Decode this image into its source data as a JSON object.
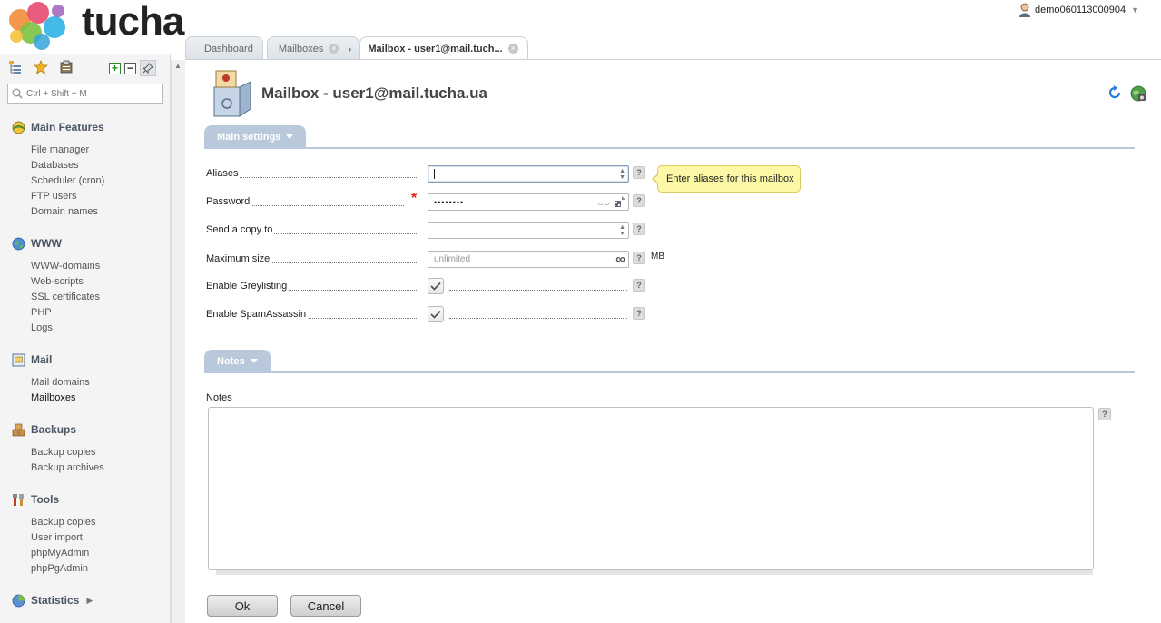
{
  "app": {
    "logo_text": "tucha"
  },
  "user_menu": {
    "username": "demo060113000904"
  },
  "tabs": [
    {
      "label": "Dashboard"
    },
    {
      "label": "Mailboxes"
    },
    {
      "label": "Mailbox - user1@mail.tuch..."
    }
  ],
  "sidebar": {
    "search_placeholder": "Ctrl + Shift + M",
    "groups": [
      {
        "title": "Main Features",
        "items": [
          "File manager",
          "Databases",
          "Scheduler (cron)",
          "FTP users",
          "Domain names"
        ]
      },
      {
        "title": "WWW",
        "items": [
          "WWW-domains",
          "Web-scripts",
          "SSL certificates",
          "PHP",
          "Logs"
        ]
      },
      {
        "title": "Mail",
        "items": [
          "Mail domains",
          "Mailboxes"
        ]
      },
      {
        "title": "Backups",
        "items": [
          "Backup copies",
          "Backup archives"
        ]
      },
      {
        "title": "Tools",
        "items": [
          "Backup copies",
          "User import",
          "phpMyAdmin",
          "phpPgAdmin"
        ]
      },
      {
        "title": "Statistics",
        "items": []
      }
    ],
    "active_item": "Mailboxes"
  },
  "main": {
    "title": "Mailbox - user1@mail.tucha.ua",
    "sections": {
      "main_settings": "Main settings",
      "notes": "Notes"
    },
    "form": {
      "aliases": {
        "label": "Aliases",
        "value": ""
      },
      "password": {
        "label": "Password",
        "value": "••••••••"
      },
      "send_copy": {
        "label": "Send a copy to",
        "value": ""
      },
      "max_size": {
        "label": "Maximum size",
        "placeholder": "unlimited",
        "unit": "MB"
      },
      "greylisting": {
        "label": "Enable Greylisting",
        "checked": true
      },
      "spamassassin": {
        "label": "Enable SpamAssassin",
        "checked": true
      }
    },
    "tooltip": "Enter aliases for this mailbox",
    "notes_label": "Notes",
    "help_glyph": "?",
    "buttons": {
      "ok": "Ok",
      "cancel": "Cancel"
    }
  },
  "colors": {
    "section_tab": "#b9c8da",
    "tooltip_bg": "#fdf8a6",
    "required": "#dd2211"
  }
}
